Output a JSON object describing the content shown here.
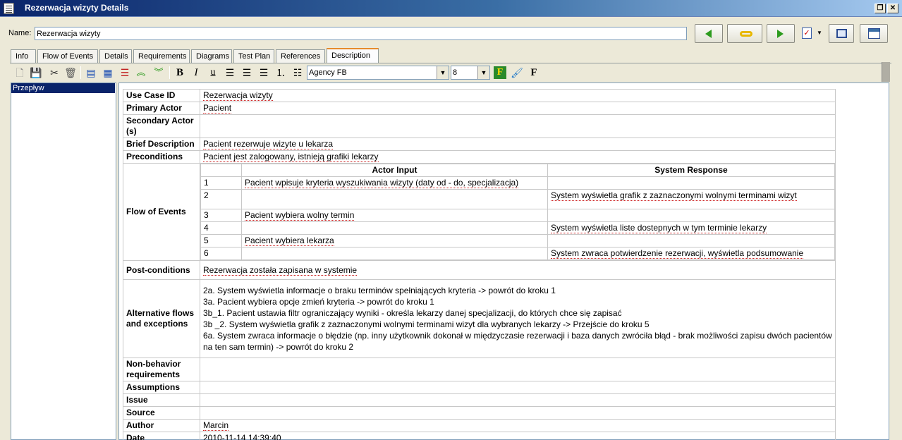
{
  "window": {
    "title": "Rezerwacja wizyty Details"
  },
  "name_field": {
    "label": "Name:",
    "value": "Rezerwacja wizyty"
  },
  "tabs": [
    "Info",
    "Flow of Events",
    "Details",
    "Requirements",
    "Diagrams",
    "Test Plan",
    "References",
    "Description"
  ],
  "active_tab": "Description",
  "toolbar": {
    "font": "Agency FB",
    "size": "8"
  },
  "tree": {
    "items": [
      "Przepływ"
    ]
  },
  "doc": {
    "use_case_id": {
      "label": "Use Case ID",
      "value": "Rezerwacja wizyty"
    },
    "primary_actor": {
      "label": "Primary Actor",
      "value": "Pacient"
    },
    "secondary_actor": {
      "label": "Secondary Actor (s)",
      "value": ""
    },
    "brief_description": {
      "label": "Brief Description",
      "value": "Pacient rezerwuje wizyte u lekarza"
    },
    "preconditions": {
      "label": "Preconditions",
      "value": "Pacient jest zalogowany, istnieją grafiki lekarzy"
    },
    "flow": {
      "label": "Flow of Events",
      "headers": {
        "num": "",
        "actor": "Actor Input",
        "system": "System Response"
      },
      "rows": [
        {
          "num": "1",
          "actor": "Pacient wpisuje kryteria wyszukiwania wizyty (daty od - do, specjalizacja)",
          "system": ""
        },
        {
          "num": "2",
          "actor": "",
          "system": "System wyświetla grafik z zaznaczonymi wolnymi terminami wizyt"
        },
        {
          "num": "3",
          "actor": "Pacient wybiera wolny termin",
          "system": ""
        },
        {
          "num": "4",
          "actor": "",
          "system": "System wyświetla liste dostepnych w tym terminie lekarzy"
        },
        {
          "num": "5",
          "actor": "Pacient wybiera lekarza",
          "system": ""
        },
        {
          "num": "6",
          "actor": "",
          "system": "System zwraca potwierdzenie rezerwacji, wyświetla podsumowanie"
        }
      ]
    },
    "post_conditions": {
      "label": "Post-conditions",
      "value": "Rezerwacja została zapisana w systemie"
    },
    "alternative": {
      "label": "Alternative flows and exceptions",
      "lines": [
        "2a. System wyświetla informacje o braku terminów spełniających kryteria -> powrót do kroku 1",
        "3a. Pacient wybiera opcje zmień kryteria -> powrót do kroku 1",
        "3b_1. Pacient ustawia filtr ograniczający wyniki - określa lekarzy danej specjalizacji, do których chce się zapisać",
        "3b _2. System wyświetla grafik z zaznaczonymi wolnymi terminami wizyt dla wybranych lekarzy -> Przejście do kroku 5",
        "6a. System zwraca informacje o błędzie (np. inny użytkownik dokonał w międzyczasie rezerwacji i baza danych zwróciła błąd - brak możliwości zapisu dwóch pacientów na ten sam termin) -> powrót do kroku 2"
      ]
    },
    "non_behavior": {
      "label": "Non-behavior requirements",
      "value": ""
    },
    "assumptions": {
      "label": "Assumptions",
      "value": ""
    },
    "issue": {
      "label": "Issue",
      "value": ""
    },
    "source": {
      "label": "Source",
      "value": ""
    },
    "author": {
      "label": "Author",
      "value": "Marcin"
    },
    "date": {
      "label": "Date",
      "value": "2010-11-14 14:39:40"
    }
  }
}
